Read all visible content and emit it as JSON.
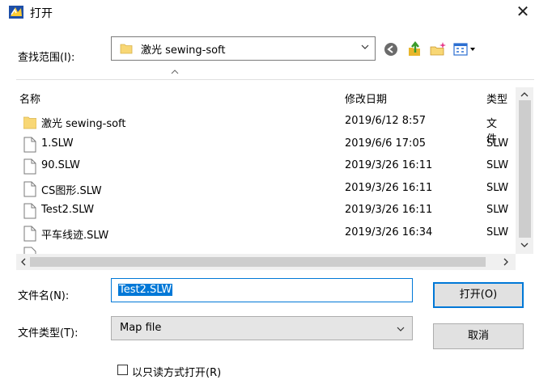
{
  "window": {
    "title": "打开",
    "close_glyph": "✕"
  },
  "toolbar": {
    "look_in_label": "查找范围(I):",
    "look_in_value": "激光 sewing-soft",
    "icons": [
      "back-icon",
      "up-folder-icon",
      "new-folder-icon",
      "view-menu-icon"
    ]
  },
  "columns": {
    "name": "名称",
    "date": "修改日期",
    "type": "类型"
  },
  "files": [
    {
      "name": "激光 sewing-soft",
      "date": "2019/6/12 8:57",
      "type": "文件",
      "icon": "folder-icon"
    },
    {
      "name": "1.SLW",
      "date": "2019/6/6 17:05",
      "type": "SLW",
      "icon": "file-icon"
    },
    {
      "name": "90.SLW",
      "date": "2019/3/26 16:11",
      "type": "SLW",
      "icon": "file-icon"
    },
    {
      "name": "CS图形.SLW",
      "date": "2019/3/26 16:11",
      "type": "SLW",
      "icon": "file-icon"
    },
    {
      "name": "Test2.SLW",
      "date": "2019/3/26 16:11",
      "type": "SLW",
      "icon": "file-icon"
    },
    {
      "name": "平车线迹.SLW",
      "date": "2019/3/26 16:34",
      "type": "SLW",
      "icon": "file-icon"
    }
  ],
  "filename": {
    "label": "文件名(N):",
    "value": "Test2.SLW"
  },
  "filetype": {
    "label": "文件类型(T):",
    "value": "Map file"
  },
  "buttons": {
    "open": "打开(O)",
    "cancel": "取消"
  },
  "readonly": {
    "label": "以只读方式打开(R)",
    "checked": false
  },
  "colors": {
    "accent": "#0078d7",
    "folder": "#f8d775"
  }
}
